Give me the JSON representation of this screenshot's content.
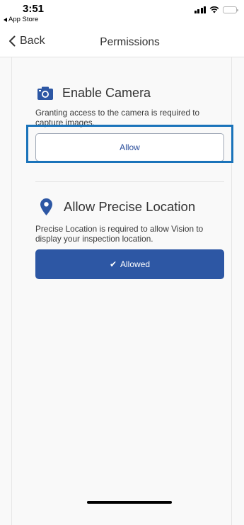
{
  "status_bar": {
    "time": "3:51",
    "back_app_label": "App Store",
    "signal_icon": "cellular-signal-icon",
    "wifi_icon": "wifi-icon",
    "battery_icon": "battery-icon"
  },
  "nav": {
    "back_label": "Back",
    "title": "Permissions"
  },
  "camera": {
    "icon": "camera-icon",
    "title": "Enable Camera",
    "description": "Granting access to the camera is required to capture images.",
    "button_label": "Allow"
  },
  "location": {
    "icon": "location-pin-icon",
    "title": "Allow Precise Location",
    "description": "Precise Location is required to allow Vision to display your inspection location.",
    "button_label": "Allowed",
    "button_icon": "checkmark-icon"
  },
  "colors": {
    "accent": "#2d57a4",
    "highlight": "#1a73ba"
  }
}
